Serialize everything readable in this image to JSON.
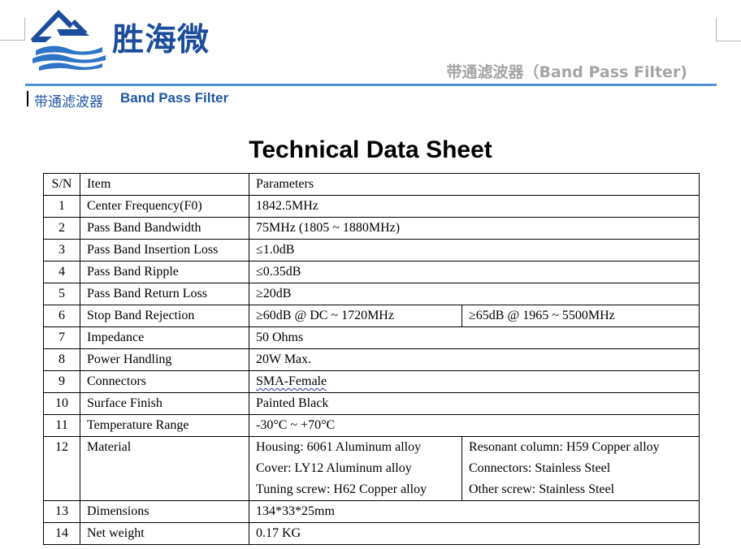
{
  "brand": {
    "logo": "shenghaiwei-wave-logo",
    "name": "胜海微",
    "primary_color": "#1c4d9c",
    "accent_color": "#4f8fd6"
  },
  "header": {
    "right_title": "带通滤波器（Band Pass Filter)",
    "sub_cn": "带通滤波器",
    "sub_en": "Band Pass Filter"
  },
  "title": "Technical Data Sheet",
  "table": {
    "headers": [
      "S/N",
      "Item",
      "Parameters"
    ],
    "rows": [
      {
        "sn": "1",
        "item": "Center Frequency(F0)",
        "value": "1842.5MHz"
      },
      {
        "sn": "2",
        "item": "Pass Band Bandwidth",
        "value": "75MHz (1805 ~ 1880MHz)"
      },
      {
        "sn": "3",
        "item": "Pass Band Insertion Loss",
        "value": "≤1.0dB"
      },
      {
        "sn": "4",
        "item": "Pass Band Ripple",
        "value": "≤0.35dB"
      },
      {
        "sn": "5",
        "item": "Pass Band Return Loss",
        "value": "≥20dB"
      },
      {
        "sn": "6",
        "item": "Stop Band Rejection",
        "value": "≥60dB @ DC ~ 1720MHz",
        "value2": "≥65dB @ 1965 ~ 5500MHz"
      },
      {
        "sn": "7",
        "item": "Impedance",
        "value": "50 Ohms"
      },
      {
        "sn": "8",
        "item": "Power Handling",
        "value": "20W Max."
      },
      {
        "sn": "9",
        "item": "Connectors",
        "value": "SMA-Female"
      },
      {
        "sn": "10",
        "item": "Surface Finish",
        "value": "Painted Black"
      },
      {
        "sn": "11",
        "item": "Temperature Range",
        "value": "-30°C ~ +70°C"
      },
      {
        "sn": "12",
        "item": "Material",
        "left": [
          "Housing: 6061 Aluminum alloy",
          "Cover: LY12 Aluminum alloy",
          "Tuning screw: H62 Copper alloy"
        ],
        "right": [
          "Resonant column: H59 Copper alloy",
          "Connectors: Stainless Steel",
          "Other screw: Stainless Steel"
        ]
      },
      {
        "sn": "13",
        "item": "Dimensions",
        "value": "134*33*25mm"
      },
      {
        "sn": "14",
        "item": "Net weight",
        "value": "0.17 KG"
      }
    ]
  }
}
